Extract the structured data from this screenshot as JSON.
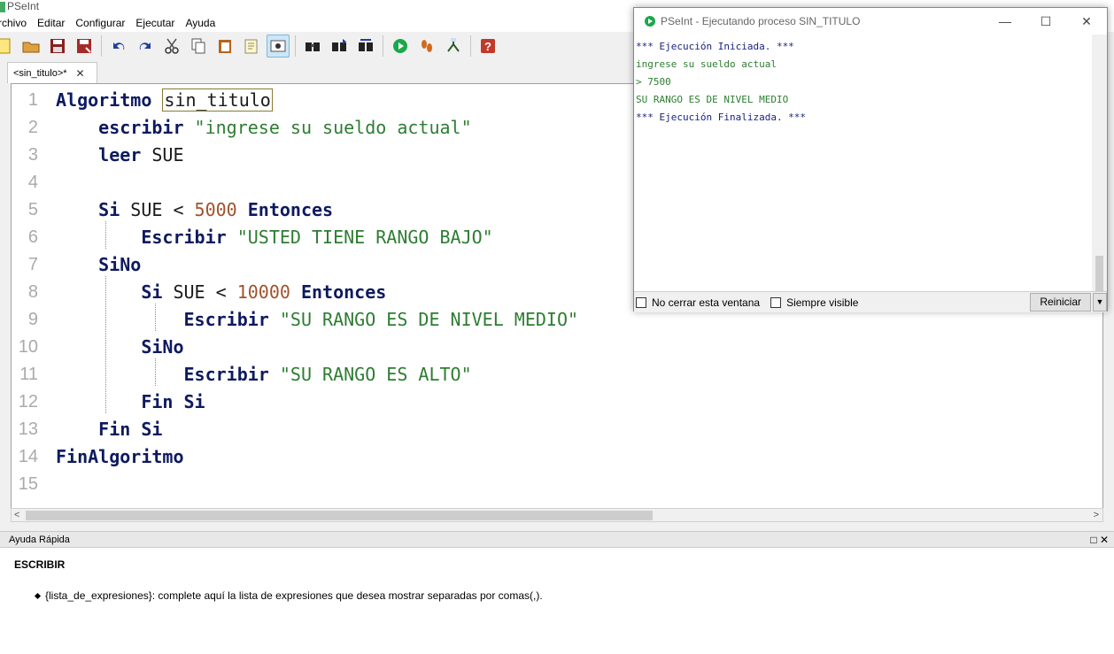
{
  "app": {
    "title": "PSeInt"
  },
  "menu": [
    "rchivo",
    "Editar",
    "Configurar",
    "Ejecutar",
    "Ayuda"
  ],
  "toolbar": {
    "icons": [
      "new-file-icon",
      "open-folder-icon",
      "save-icon",
      "save-as-icon",
      "undo-icon",
      "redo-icon",
      "cut-icon",
      "copy-icon",
      "paste-icon",
      "edit-icon",
      "indent-icon",
      "search-icon",
      "find-next-icon",
      "replace-icon",
      "run-icon",
      "step-icon",
      "diagram-icon",
      "help-icon"
    ]
  },
  "tab": {
    "label": "<sin_titulo>*",
    "close": "✕"
  },
  "editor": {
    "line_numbers": [
      "1",
      "2",
      "3",
      "4",
      "5",
      "6",
      "7",
      "8",
      "9",
      "10",
      "11",
      "12",
      "13",
      "14",
      "15"
    ],
    "lines": [
      [
        {
          "t": "kw",
          "v": "Algoritmo "
        },
        {
          "t": "box",
          "v": "sin_titulo"
        }
      ],
      [
        {
          "t": "sp",
          "v": "    "
        },
        {
          "t": "kw",
          "v": "escribir "
        },
        {
          "t": "str",
          "v": "\"ingrese su sueldo actual\""
        }
      ],
      [
        {
          "t": "sp",
          "v": "    "
        },
        {
          "t": "kw",
          "v": "leer "
        },
        {
          "t": "id",
          "v": "SUE"
        }
      ],
      [],
      [
        {
          "t": "sp",
          "v": "    "
        },
        {
          "t": "kw",
          "v": "Si "
        },
        {
          "t": "id",
          "v": "SUE < "
        },
        {
          "t": "num",
          "v": "5000"
        },
        {
          "t": "kw",
          "v": " Entonces"
        }
      ],
      [
        {
          "t": "sp",
          "v": "        "
        },
        {
          "t": "kw",
          "v": "Escribir "
        },
        {
          "t": "str",
          "v": "\"USTED TIENE RANGO BAJO\""
        }
      ],
      [
        {
          "t": "sp",
          "v": "    "
        },
        {
          "t": "kw",
          "v": "SiNo"
        }
      ],
      [
        {
          "t": "sp",
          "v": "        "
        },
        {
          "t": "kw",
          "v": "Si "
        },
        {
          "t": "id",
          "v": "SUE < "
        },
        {
          "t": "num",
          "v": "10000"
        },
        {
          "t": "kw",
          "v": " Entonces"
        }
      ],
      [
        {
          "t": "sp",
          "v": "            "
        },
        {
          "t": "kw",
          "v": "Escribir "
        },
        {
          "t": "str",
          "v": "\"SU RANGO ES DE NIVEL MEDIO\""
        }
      ],
      [
        {
          "t": "sp",
          "v": "        "
        },
        {
          "t": "kw",
          "v": "SiNo"
        }
      ],
      [
        {
          "t": "sp",
          "v": "            "
        },
        {
          "t": "kw",
          "v": "Escribir "
        },
        {
          "t": "str",
          "v": "\"SU RANGO ES ALTO\""
        }
      ],
      [
        {
          "t": "sp",
          "v": "        "
        },
        {
          "t": "kw",
          "v": "Fin Si"
        }
      ],
      [
        {
          "t": "sp",
          "v": "    "
        },
        {
          "t": "kw",
          "v": "Fin Si"
        }
      ],
      [
        {
          "t": "kw",
          "v": "FinAlgoritmo"
        }
      ],
      []
    ]
  },
  "help": {
    "header": "Ayuda Rápida",
    "title": "ESCRIBIR",
    "bullet": "{lista_de_expresiones}: complete aquí la lista de expresiones que desea mostrar separadas por comas(,)."
  },
  "run_window": {
    "title": "PSeInt - Ejecutando proceso SIN_TITULO",
    "output": [
      {
        "kind": "sys",
        "text": "*** Ejecución Iniciada. ***"
      },
      {
        "kind": "msg",
        "text": "ingrese su sueldo actual"
      },
      {
        "kind": "msg",
        "text": "> 7500"
      },
      {
        "kind": "msg",
        "text": "SU RANGO ES DE NIVEL MEDIO"
      },
      {
        "kind": "sys",
        "text": "*** Ejecución Finalizada. ***"
      }
    ],
    "checkbox_keep_open": "No cerrar esta ventana",
    "checkbox_always_visible": "Siempre visible",
    "restart_label": "Reiniciar"
  }
}
